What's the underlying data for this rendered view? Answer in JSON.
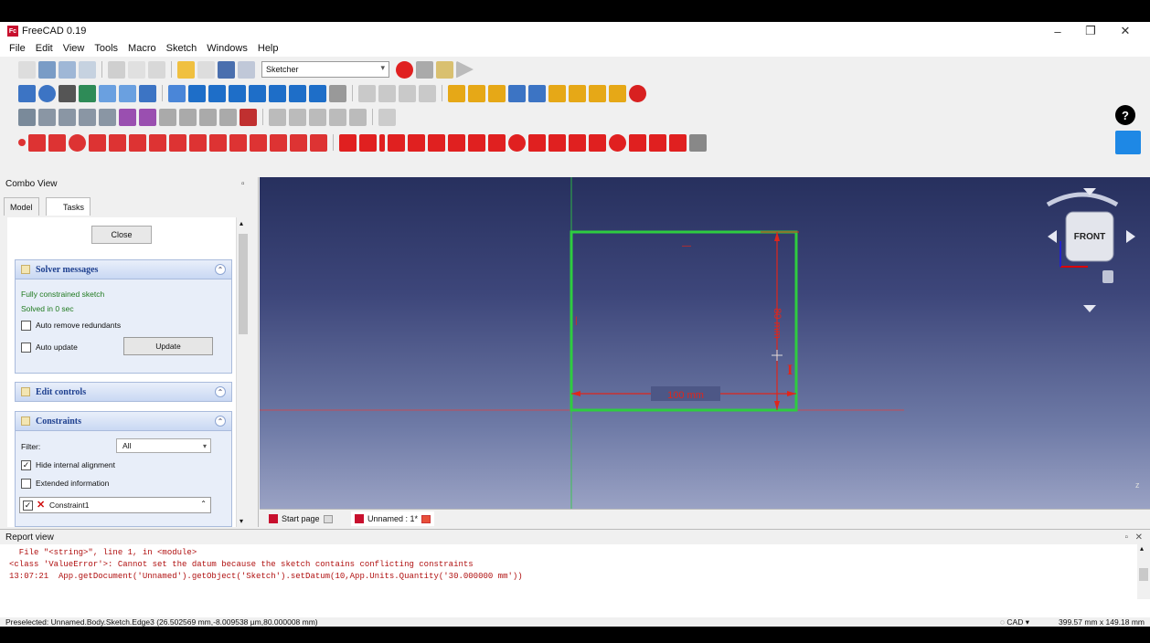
{
  "window": {
    "title": "FreeCAD 0.19",
    "app_icon_text": "Fc",
    "min": "–",
    "max": "❐",
    "close": "✕"
  },
  "menu": [
    "File",
    "Edit",
    "View",
    "Tools",
    "Macro",
    "Sketch",
    "Windows",
    "Help"
  ],
  "workbench": {
    "selected": "Sketcher"
  },
  "combo": {
    "title": "Combo View",
    "tabs": [
      "Model",
      "Tasks"
    ],
    "close_label": "Close",
    "solver": {
      "title": "Solver messages",
      "status": "Fully constrained sketch",
      "time": "Solved in 0 sec",
      "auto_remove": "Auto remove redundants",
      "auto_update": "Auto update",
      "update_label": "Update"
    },
    "edit_controls": {
      "title": "Edit controls"
    },
    "constraints": {
      "title": "Constraints",
      "filter_label": "Filter:",
      "filter_value": "All",
      "hide_internal": "Hide internal alignment",
      "extended": "Extended information",
      "item": "Constraint1"
    }
  },
  "viewport": {
    "dim_horizontal": "100 mm",
    "dim_vertical": "80 mm",
    "navcube_face": "FRONT",
    "axis_label": "z"
  },
  "doc_tabs": [
    "Start page",
    "Unnamed : 1*"
  ],
  "report": {
    "title": "Report view",
    "lines": [
      "  File \"<string>\", line 1, in <module>",
      "<class 'ValueError'>: Cannot set the datum because the sketch contains conflicting constraints",
      "13:07:21  App.getDocument('Unnamed').getObject('Sketch').setDatum(10,App.Units.Quantity('30.000000 mm'))"
    ]
  },
  "status": {
    "preselected": "Preselected: Unnamed.Body.Sketch.Edge3 (26.502569 mm,-8.009538 µm,80.000008 mm)",
    "nav_style": "CAD",
    "dimensions": "399.57 mm x 149.18 mm"
  },
  "colors": {
    "sketch_green": "#2ecc40",
    "dim_red": "#e0261b",
    "accent_blue": "#1e88e5"
  }
}
